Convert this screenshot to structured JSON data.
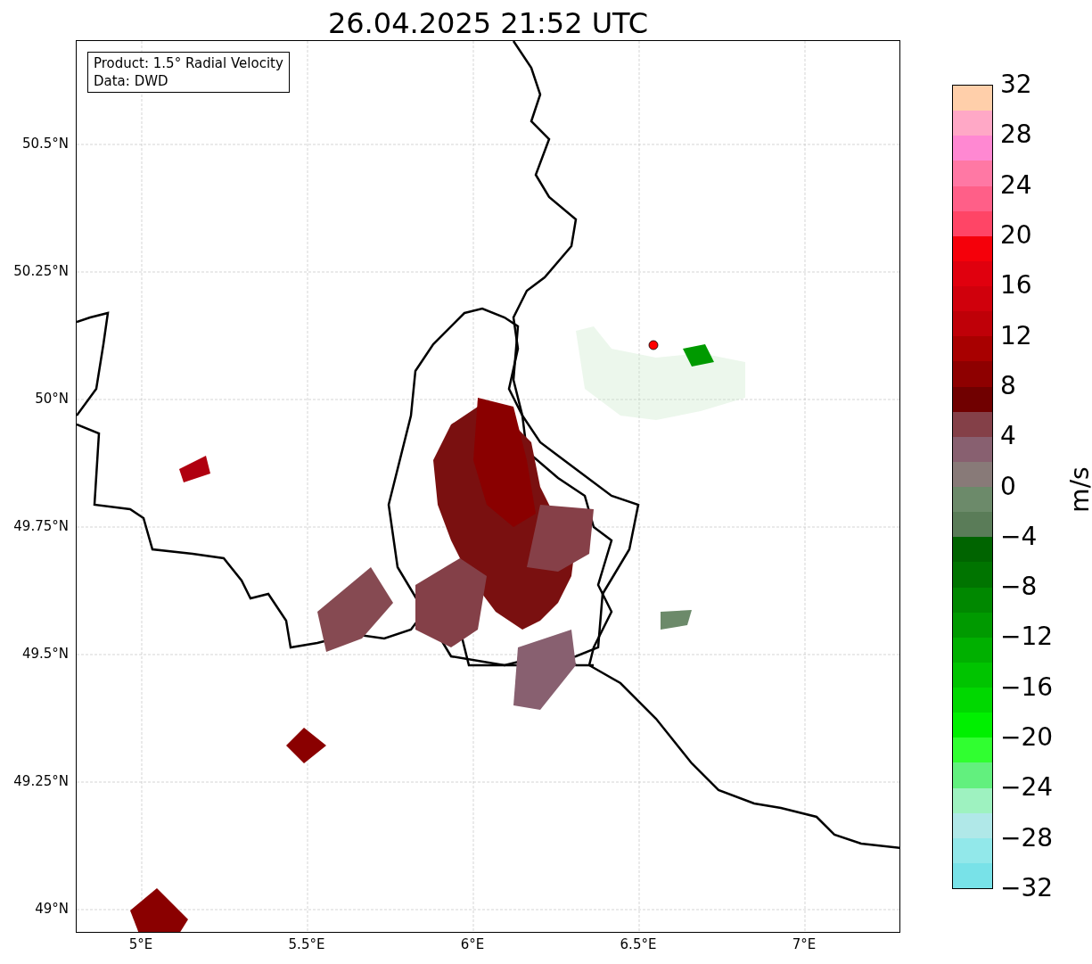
{
  "title": "26.04.2025 21:52 UTC",
  "info_box": [
    "Product: 1.5° Radial Velocity",
    "Data: DWD"
  ],
  "lat_labels": [
    "50.5°N",
    "50.25°N",
    "50°N",
    "49.75°N",
    "49.5°N",
    "49.25°N",
    "49°N"
  ],
  "lon_labels": [
    "5°E",
    "5.5°E",
    "6°E",
    "6.5°E",
    "7°E"
  ],
  "colorbar": {
    "label": "m/s",
    "ticks": [
      "32",
      "28",
      "24",
      "20",
      "16",
      "12",
      "8",
      "4",
      "0",
      "−4",
      "−8",
      "−12",
      "−16",
      "−20",
      "−24",
      "−28",
      "−32"
    ],
    "segments": [
      {
        "color": "#ffcfaa"
      },
      {
        "color": "#ffa8c6"
      },
      {
        "color": "#ff88d2"
      },
      {
        "color": "#ff78a4"
      },
      {
        "color": "#ff5f88"
      },
      {
        "color": "#ff4566"
      },
      {
        "color": "#f5000a"
      },
      {
        "color": "#e0000e"
      },
      {
        "color": "#d0000c"
      },
      {
        "color": "#bf0008"
      },
      {
        "color": "#a80000"
      },
      {
        "color": "#8e0000"
      },
      {
        "color": "#700000"
      },
      {
        "color": "#844048"
      },
      {
        "color": "#886070"
      },
      {
        "color": "#887a78"
      },
      {
        "color": "#6c8a6a"
      },
      {
        "color": "#5a7c58"
      },
      {
        "color": "#006400"
      },
      {
        "color": "#007400"
      },
      {
        "color": "#008800"
      },
      {
        "color": "#009a00"
      },
      {
        "color": "#00b000"
      },
      {
        "color": "#00c400"
      },
      {
        "color": "#00d800"
      },
      {
        "color": "#00f000"
      },
      {
        "color": "#30ff30"
      },
      {
        "color": "#62f07e"
      },
      {
        "color": "#9ef2c0"
      },
      {
        "color": "#b0e8e8"
      },
      {
        "color": "#92e8ea"
      },
      {
        "color": "#78e2e8"
      }
    ]
  }
}
